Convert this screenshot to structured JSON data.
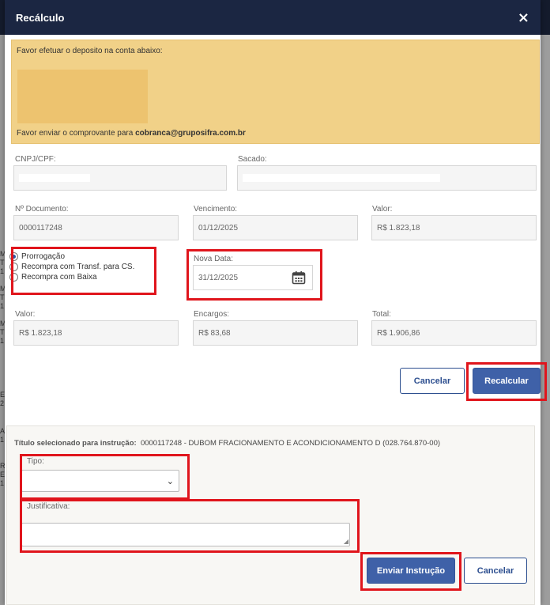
{
  "background": {
    "fragments": [
      "M",
      "T",
      "1",
      "M",
      "T",
      "1",
      "M",
      "T",
      "1",
      "E",
      "2",
      "A",
      "1",
      "R",
      "E",
      "1"
    ]
  },
  "modal": {
    "title": "Recálculo",
    "close_icon": "×"
  },
  "notice": {
    "deposit_text": "Favor efetuar o deposito na conta abaixo:",
    "proof_text_prefix": "Favor enviar o comprovante para ",
    "proof_email": "cobranca@gruposifra.com.br",
    "color": "#f1d188"
  },
  "fields": {
    "cnpj_label": "CNPJ/CPF:",
    "cnpj_value": "",
    "sacado_label": "Sacado:",
    "sacado_value": "",
    "documento_label": "Nº Documento:",
    "documento_value": "0000117248",
    "vencimento_label": "Vencimento:",
    "vencimento_value": "01/12/2025",
    "valor_top_label": "Valor:",
    "valor_top_value": "R$ 1.823,18",
    "nova_data_label": "Nova Data:",
    "nova_data_value": "31/12/2025",
    "valor_label": "Valor:",
    "valor_value": "R$ 1.823,18",
    "encargos_label": "Encargos:",
    "encargos_value": "R$ 83,68",
    "total_label": "Total:",
    "total_value": "R$ 1.906,86"
  },
  "options": [
    {
      "label": "Prorrogação",
      "checked": true
    },
    {
      "label": "Recompra com Transf. para CS.",
      "checked": false
    },
    {
      "label": "Recompra com Baixa",
      "checked": false
    }
  ],
  "buttons": {
    "cancel_top": "Cancelar",
    "recalc": "Recalcular",
    "send": "Enviar Instrução",
    "cancel_bottom": "Cancelar"
  },
  "instruction": {
    "selected_label": "Título selecionado para instrução:",
    "selected_value": "0000117248 - DUBOM FRACIONAMENTO E ACONDICIONAMENTO D (028.764.870-00)",
    "tipo_label": "Tipo:",
    "tipo_value": "",
    "justificativa_label": "Justificativa:",
    "justificativa_value": ""
  },
  "colors": {
    "header": "#1b2642",
    "primary": "#3f61a8",
    "highlight": "#e0151c"
  },
  "icons": {
    "calendar": "calendar-icon",
    "chevron": "chevron-down-icon",
    "close": "close-icon"
  }
}
